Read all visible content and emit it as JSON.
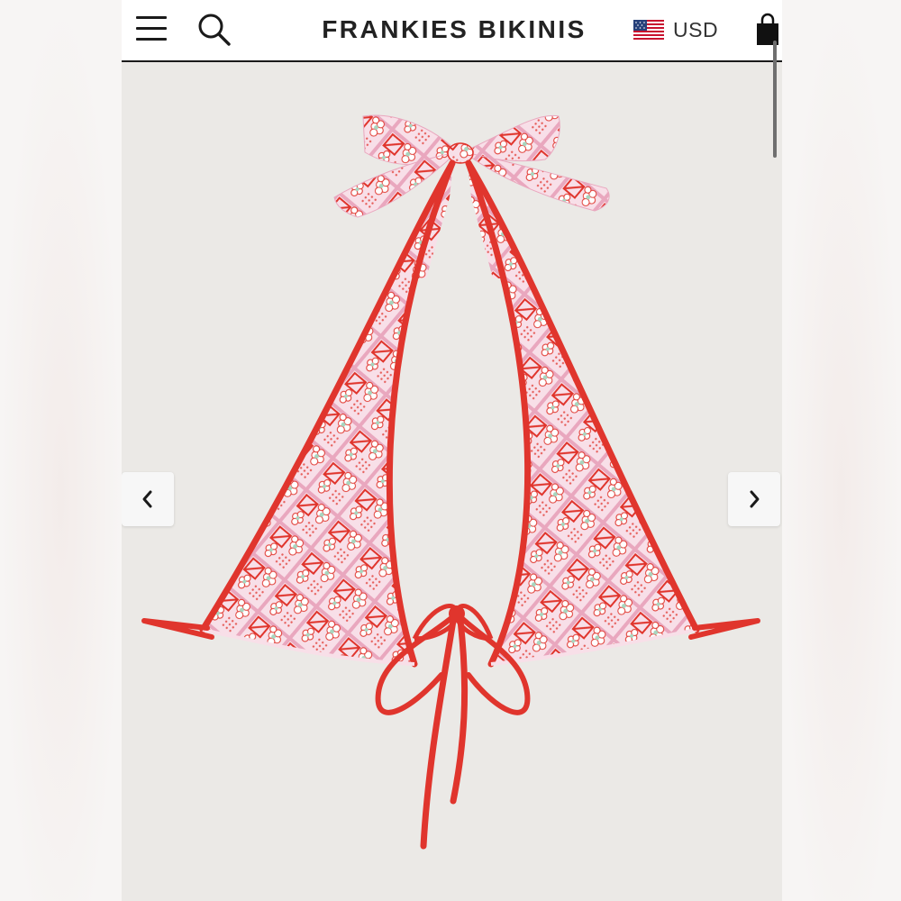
{
  "header": {
    "brand": "FRANKIES BIKINIS",
    "currency": "USD",
    "icons": {
      "menu": "hamburger-menu-icon",
      "search": "search-icon",
      "flag": "us-flag-icon",
      "cart": "shopping-bag-icon"
    }
  },
  "gallery": {
    "image": "red and pink printed halter triangle bikini top",
    "prev_icon": "chevron-left-icon",
    "next_icon": "chevron-right-icon"
  },
  "colors": {
    "background": "#ebe9e6",
    "trim": "#e0352d",
    "fabric": "#f8dfe8",
    "accent_green": "#a7d6bf"
  }
}
